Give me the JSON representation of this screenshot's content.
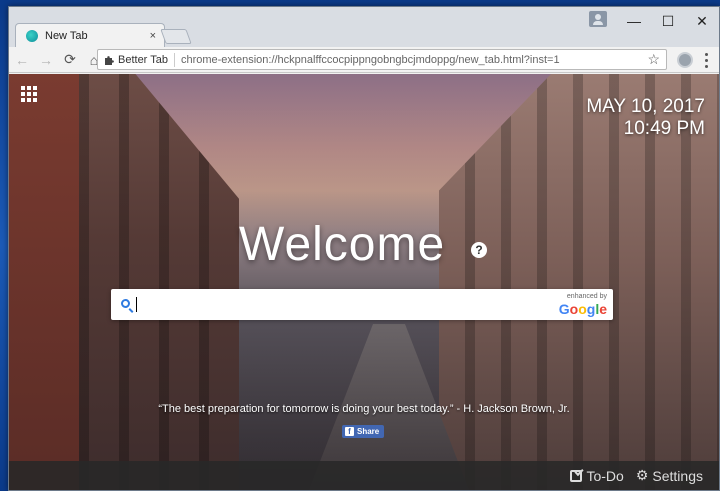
{
  "browser": {
    "tab_title": "New Tab",
    "tab_close": "×",
    "window_controls": {
      "minimize": "—",
      "maximize": "☐",
      "close": "✕"
    },
    "nav": {
      "back": "←",
      "forward": "→",
      "reload": "⟳",
      "home": "⌂"
    },
    "omnibox": {
      "extension_label": "Better Tab",
      "url": "chrome-extension://hckpnalffccocpippngobngbcjmdoppg/new_tab.html?inst=1",
      "star": "☆"
    }
  },
  "page": {
    "date": "MAY 10, 2017",
    "time": "10:49 PM",
    "welcome": "Welcome",
    "help": "?",
    "search": {
      "value": "",
      "placeholder": ""
    },
    "enhanced_by": "enhanced by",
    "google": [
      "G",
      "o",
      "o",
      "g",
      "l",
      "e"
    ],
    "quote": "“The best preparation for tomorrow is doing your best today.” - H. Jackson Brown, Jr.",
    "share_label": "Share",
    "bottom": {
      "todo": "To-Do",
      "settings": "Settings"
    }
  },
  "colors": {
    "google": [
      "#4285f4",
      "#ea4335",
      "#fbbc05",
      "#4285f4",
      "#34a853",
      "#ea4335"
    ],
    "facebook": "#4267b2"
  }
}
